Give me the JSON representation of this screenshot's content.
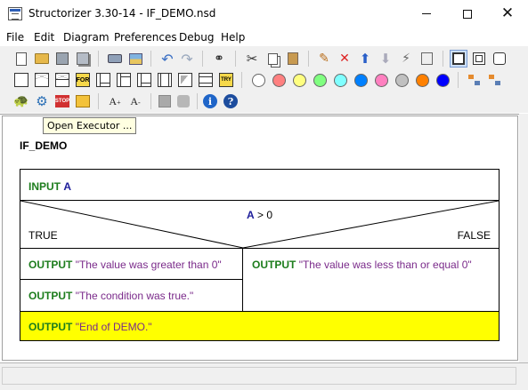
{
  "window": {
    "title": "Structorizer 3.30-14 - IF_DEMO.nsd"
  },
  "menu": [
    "File",
    "Edit",
    "Diagram",
    "Preferences",
    "Debug",
    "Help"
  ],
  "toolbar": {
    "row1": [
      "new-icon",
      "open-icon",
      "save-icon",
      "save-as-icon",
      "print-icon",
      "export-picture-icon",
      "undo-icon",
      "redo-icon",
      "find-icon",
      "cut-icon",
      "copy-icon",
      "paste-icon",
      "edit-element-icon",
      "delete-element-icon",
      "move-up-icon",
      "move-down-icon",
      "transmute-icon",
      "element-properties-icon",
      "nsd-view-icon",
      "nsd-view-alt-icon",
      "nsd-view-rounded-icon"
    ],
    "row2_elements": [
      "instruction-icon",
      "if-icon",
      "case-icon",
      "for-icon",
      "while-icon",
      "repeat-icon",
      "forever-icon",
      "call-icon",
      "jump-icon",
      "parallel-icon",
      "try-icon"
    ],
    "colors": [
      "#ffffff",
      "#ff8080",
      "#ffff80",
      "#80ff80",
      "#80ffff",
      "#0080ff",
      "#ff80c0",
      "#c0c0c0",
      "#ff8000",
      "#0000ff"
    ],
    "row3": [
      "turtle-icon",
      "executor-icon",
      "stop-icon",
      "arranger-icon",
      "font-up-icon",
      "font-down-icon",
      "disabled-icon",
      "disabled-alt-icon",
      "info-icon",
      "help-icon"
    ],
    "font_labels": {
      "up": "A",
      "up_sup": "+",
      "down": "A",
      "down_sup": "-"
    },
    "stop_label": "STOP",
    "for_label": "FOR",
    "try_label": "TRY",
    "info_label": "i",
    "help_label": "?"
  },
  "tooltip": {
    "text": "Open Executor ..."
  },
  "diagram": {
    "title": "IF_DEMO",
    "input": {
      "keyword": "INPUT",
      "var": "A"
    },
    "condition": {
      "var": "A",
      "op": "> 0"
    },
    "true_label": "TRUE",
    "false_label": "FALSE",
    "true_branch": [
      {
        "keyword": "OUTPUT",
        "text": "\"The value was greater than 0\""
      },
      {
        "keyword": "OUTPUT",
        "text": "\"The condition was true.\""
      }
    ],
    "false_branch": [
      {
        "keyword": "OUTPUT",
        "text": "\"The value was less than or equal 0\""
      }
    ],
    "final": {
      "keyword": "OUTPUT",
      "text": "\"End of DEMO.\"",
      "bg": "#ffff00"
    }
  },
  "colors": {
    "keyword": "#1d7d1d",
    "variable": "#1d1d9a",
    "string": "#7a2a8a"
  }
}
